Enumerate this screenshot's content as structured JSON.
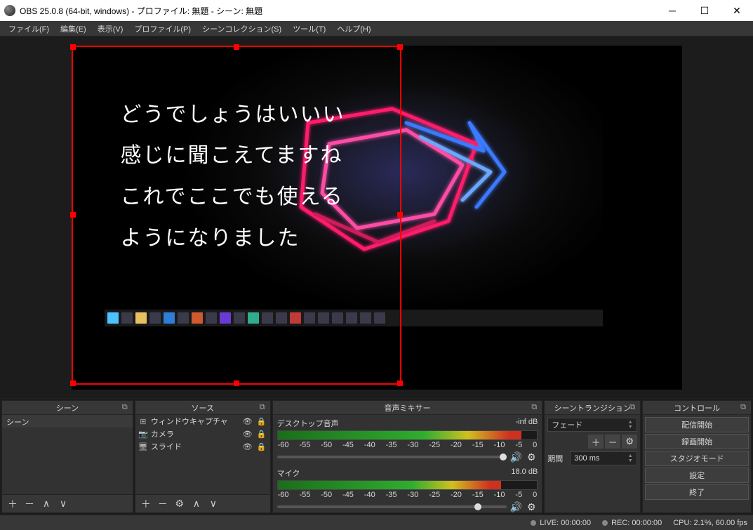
{
  "window": {
    "title": "OBS 25.0.8 (64-bit, windows) - プロファイル: 無題 - シーン: 無題"
  },
  "menu": {
    "file": "ファイル(F)",
    "edit": "編集(E)",
    "view": "表示(V)",
    "profile": "プロファイル(P)",
    "scene_collection": "シーンコレクション(S)",
    "tools": "ツール(T)",
    "help": "ヘルプ(H)"
  },
  "caption_overlay": "どうでしょうはいいい\n感じに聞こえてますね\nこれでここでも使える\nようになりました",
  "docks": {
    "scenes": {
      "title": "シーン",
      "items": [
        "シーン"
      ]
    },
    "sources": {
      "title": "ソース",
      "items": [
        {
          "icon": "window",
          "name": "ウィンドウキャプチャ"
        },
        {
          "icon": "camera",
          "name": "カメラ"
        },
        {
          "icon": "capture",
          "name": "スライド"
        }
      ]
    },
    "mixer": {
      "title": "音声ミキサー",
      "channels": [
        {
          "name": "デスクトップ音声",
          "level": "-inf dB",
          "bar_pct": 94,
          "knob_pct": 97
        },
        {
          "name": "マイク",
          "level": "18.0 dB",
          "bar_pct": 86,
          "knob_pct": 86
        }
      ],
      "ticks": [
        "-60",
        "-55",
        "-50",
        "-45",
        "-40",
        "-35",
        "-30",
        "-25",
        "-20",
        "-15",
        "-10",
        "-5",
        "0"
      ]
    },
    "transitions": {
      "title": "シーントランジション",
      "selected": "フェード",
      "duration_label": "期間",
      "duration_value": "300 ms"
    },
    "controls": {
      "title": "コントロール",
      "buttons": [
        "配信開始",
        "録画開始",
        "スタジオモード",
        "設定",
        "終了"
      ]
    }
  },
  "status": {
    "live": "LIVE: 00:00:00",
    "rec": "REC: 00:00:00",
    "cpu": "CPU: 2.1%, 60.00 fps"
  }
}
